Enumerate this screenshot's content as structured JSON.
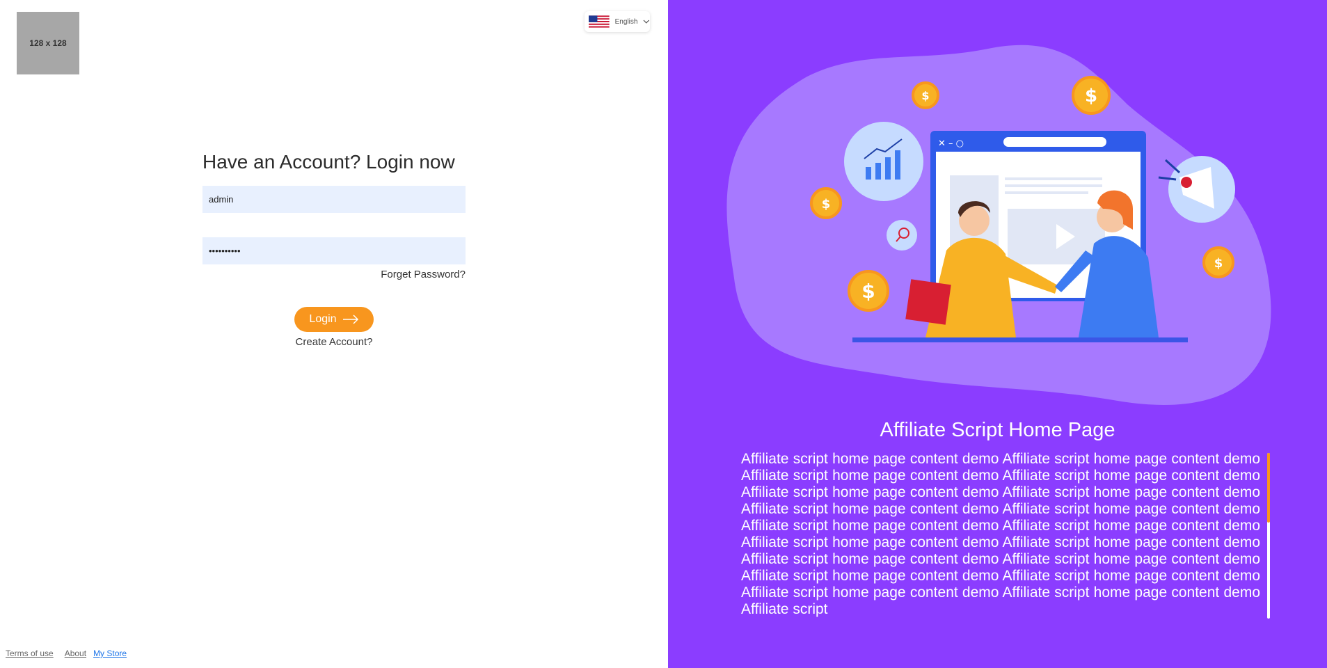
{
  "logo": {
    "text": "128 x 128"
  },
  "language": {
    "selected": "English",
    "flag_icon": "us-flag-icon"
  },
  "login": {
    "title": "Have an Account? Login now",
    "username_value": "admin",
    "password_value": "••••••••••",
    "forgot_label": "Forget Password?",
    "button_label": "Login",
    "create_label": "Create Account?"
  },
  "footer": {
    "terms": "Terms of use",
    "about": "About",
    "store": "My Store"
  },
  "hero": {
    "title": "Affiliate Script Home Page",
    "body": "Affiliate script home page content demo Affiliate script home page content demo Affiliate script home page content demo Affiliate script home page content demo Affiliate script home page content demo Affiliate script home page content demo Affiliate script home page content demo Affiliate script home page content demo Affiliate script home page content demo Affiliate script home page content demo Affiliate script home page content demo Affiliate script home page content demo Affiliate script home page content demo Affiliate script home page content demo Affiliate script home page content demo Affiliate script home page content demo Affiliate script home page content demo Affiliate script home page content demo Affiliate script"
  },
  "colors": {
    "accent": "#f8961e",
    "hero_bg": "#8b3dff",
    "input_bg": "#e8f0fe"
  }
}
